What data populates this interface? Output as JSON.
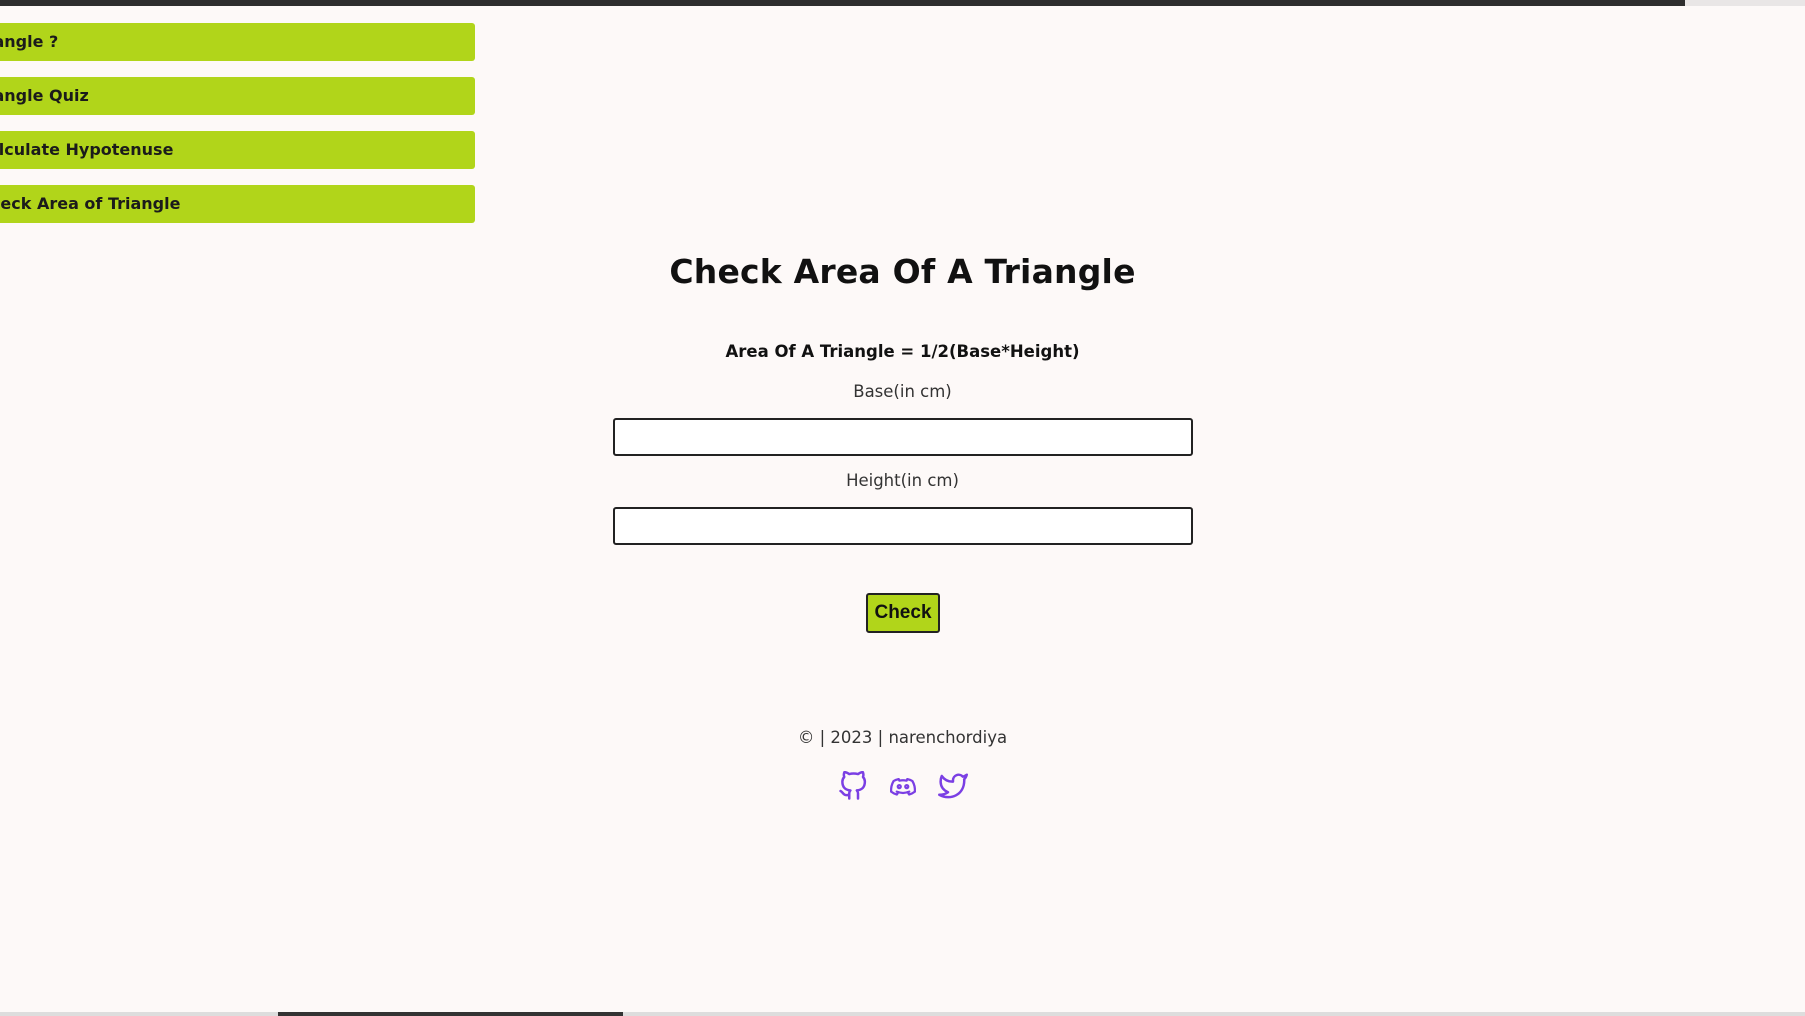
{
  "nav": {
    "items": [
      {
        "label": "Triangle ?"
      },
      {
        "label": "Triangle Quiz"
      },
      {
        "label": "Calculate Hypotenuse"
      },
      {
        "label": "Check Area of Triangle"
      }
    ],
    "visible_labels": [
      "iangle ?",
      "iangle Quiz",
      "alculate Hypotenuse",
      "heck Area of Triangle"
    ]
  },
  "main": {
    "title": "Check Area Of A Triangle",
    "formula": "Area Of A Triangle = 1/2(Base*Height)",
    "base_label": "Base(in cm)",
    "base_value": "",
    "height_label": "Height(in cm)",
    "height_value": "",
    "check_label": "Check"
  },
  "footer": {
    "text": "© | 2023 | narenchordiya",
    "socials": [
      "github-icon",
      "discord-icon",
      "twitter-icon"
    ]
  },
  "colors": {
    "accent": "#b1d51a",
    "icon": "#7b3fe4",
    "background": "#fdf9f8"
  }
}
